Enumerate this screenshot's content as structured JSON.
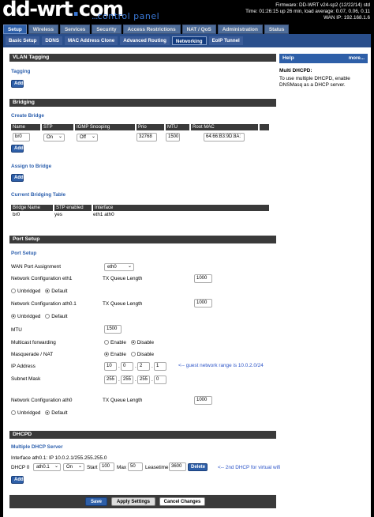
{
  "header": {
    "logo_main": "dd-wrt",
    "logo_dot": ".",
    "logo_com": "com",
    "control_dots": "...",
    "control_panel": "control panel",
    "firmware": "Firmware: DD-WRT v24-sp2 (12/22/14) std",
    "time": "Time: 01:26:15 up 26 min, load average: 0.07, 0.06, 0.11",
    "wan_ip": "WAN IP: 192.168.1.6"
  },
  "top_tabs": [
    "Setup",
    "Wireless",
    "Services",
    "Security",
    "Access Restrictions",
    "NAT / QoS",
    "Administration",
    "Status"
  ],
  "sub_tabs": [
    "Basic Setup",
    "DDNS",
    "MAC Address Clone",
    "Advanced Routing",
    "Networking",
    "EoIP Tunnel"
  ],
  "vlan": {
    "title": "VLAN Tagging",
    "tagging": "Tagging",
    "add": "Add"
  },
  "bridging": {
    "title": "Bridging",
    "create": "Create Bridge",
    "headers": [
      "Name",
      "STP",
      "IGMP Snooping",
      "Prio",
      "MTU",
      "Root MAC"
    ],
    "row": {
      "name": "br0",
      "stp": "On",
      "igmp": "Off",
      "prio": "32768",
      "mtu": "1500",
      "mac": "64:66:B3:9D:8A:"
    },
    "add": "Add",
    "assign": "Assign to Bridge",
    "assign_add": "Add",
    "current": "Current Bridging Table",
    "table_headers": [
      "Bridge Name",
      "STP enabled",
      "Interface"
    ],
    "table_row": {
      "name": "br0",
      "stp": "yes",
      "iface": "eth1 ath0"
    }
  },
  "port": {
    "title": "Port Setup",
    "subtitle": "Port Setup",
    "wan_label": "WAN Port Assignment",
    "wan_value": "eth0",
    "cfg_eth1": "Network Configuration eth1",
    "txq": "TX Queue Length",
    "txq_eth1": "1000",
    "unbridged": "Unbridged",
    "default": "Default",
    "cfg_ath01": "Network Configuration ath0.1",
    "txq_ath01": "1000",
    "mtu_label": "MTU",
    "mtu_value": "1500",
    "mcast": "Multicast forwarding",
    "masq": "Masquerade / NAT",
    "enable": "Enable",
    "disable": "Disable",
    "ip_label": "IP Address",
    "ip": [
      "10",
      "0",
      "2",
      "1"
    ],
    "ip_note": "<-- guest network range is 10.0.2.0/24",
    "mask_label": "Subnet Mask",
    "mask": [
      "255",
      "255",
      "255",
      "0"
    ],
    "cfg_ath0": "Network Configuration ath0",
    "txq_ath0": "1000"
  },
  "dhcpd": {
    "title": "DHCPD",
    "subtitle": "Multiple DHCP Server",
    "iface_line": "Interface ath0.1: IP 10.0.2.1/255.255.255.0",
    "dhcp0": "DHCP 0",
    "iface": "ath0.1",
    "state": "On",
    "start_label": "Start",
    "start": "100",
    "max_label": "Max",
    "max": "50",
    "lease_label": "Leasetime",
    "lease": "3600",
    "delete": "Delete",
    "note": "<-- 2nd DHCP for virtual wifi",
    "add": "Add"
  },
  "help": {
    "title": "Help",
    "more": "more...",
    "topic": "Multi DHCPD:",
    "text": "To use multiple DHCPD, enable DNSMasq as a DHCP server."
  },
  "footer": {
    "save": "Save",
    "apply": "Apply Settings",
    "cancel": "Cancel Changes"
  }
}
